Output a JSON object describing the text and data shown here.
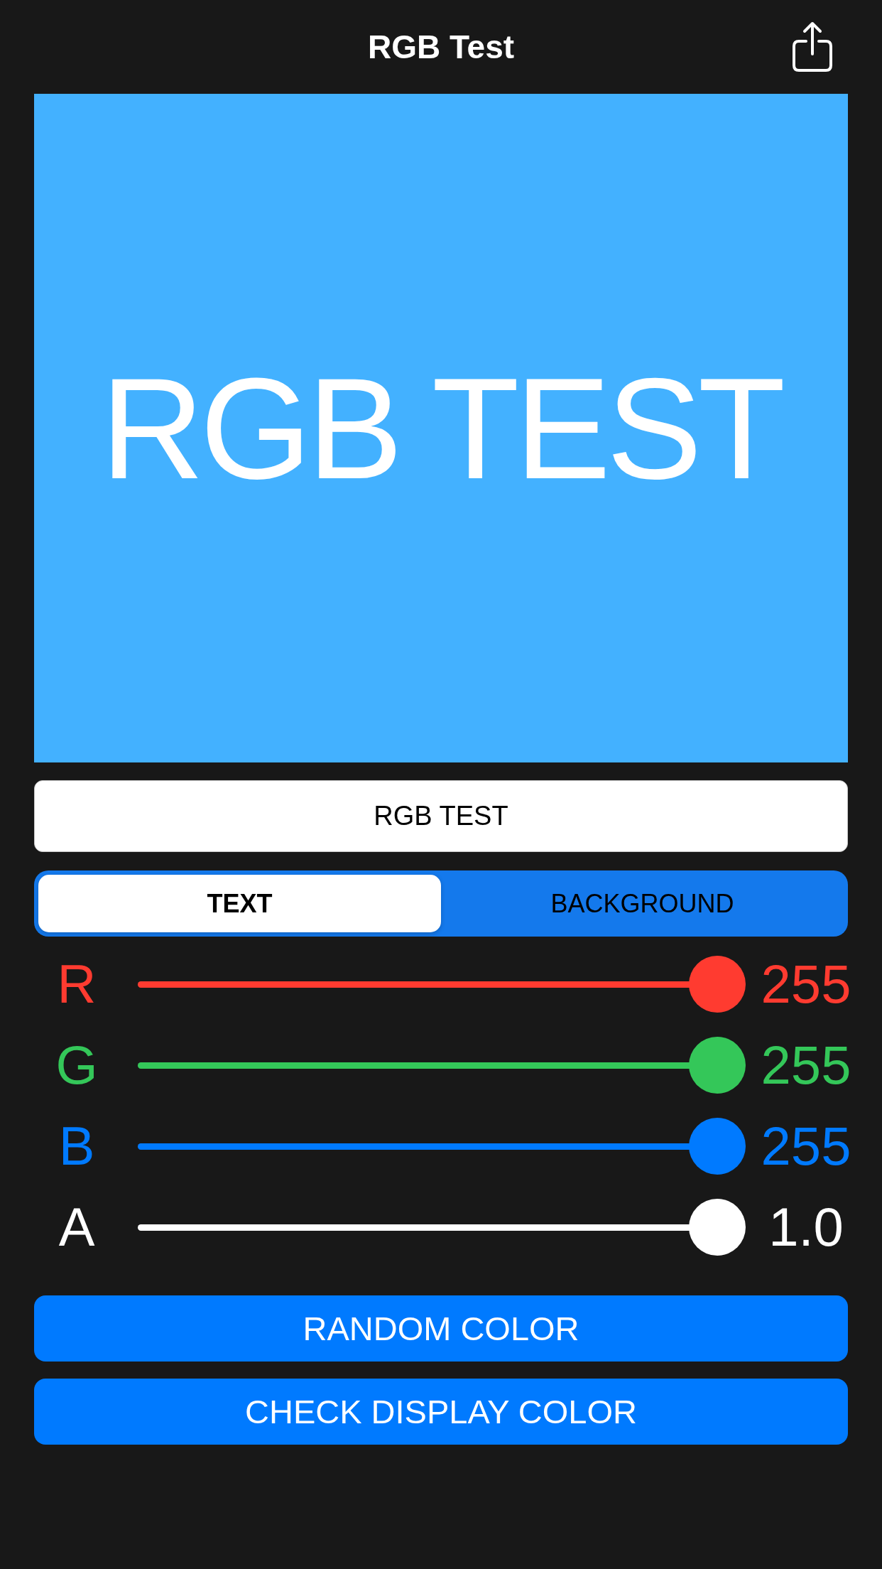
{
  "nav": {
    "title": "RGB Test"
  },
  "preview": {
    "text": "RGB TEST"
  },
  "text_field": {
    "value": "RGB TEST"
  },
  "segments": [
    {
      "label": "TEXT",
      "selected": true
    },
    {
      "label": "BACKGROUND",
      "selected": false
    }
  ],
  "channels": [
    {
      "label": "R",
      "value": "255",
      "level": 1,
      "color": "#ff3b30"
    },
    {
      "label": "G",
      "value": "255",
      "level": 1,
      "color": "#34c759"
    },
    {
      "label": "B",
      "value": "255",
      "level": 1,
      "color": "#007aff"
    },
    {
      "label": "A",
      "value": "1.0",
      "level": 1,
      "color": "#ffffff"
    }
  ],
  "buttons": [
    "RANDOM COLOR",
    "CHECK DISPLAY COLOR"
  ]
}
